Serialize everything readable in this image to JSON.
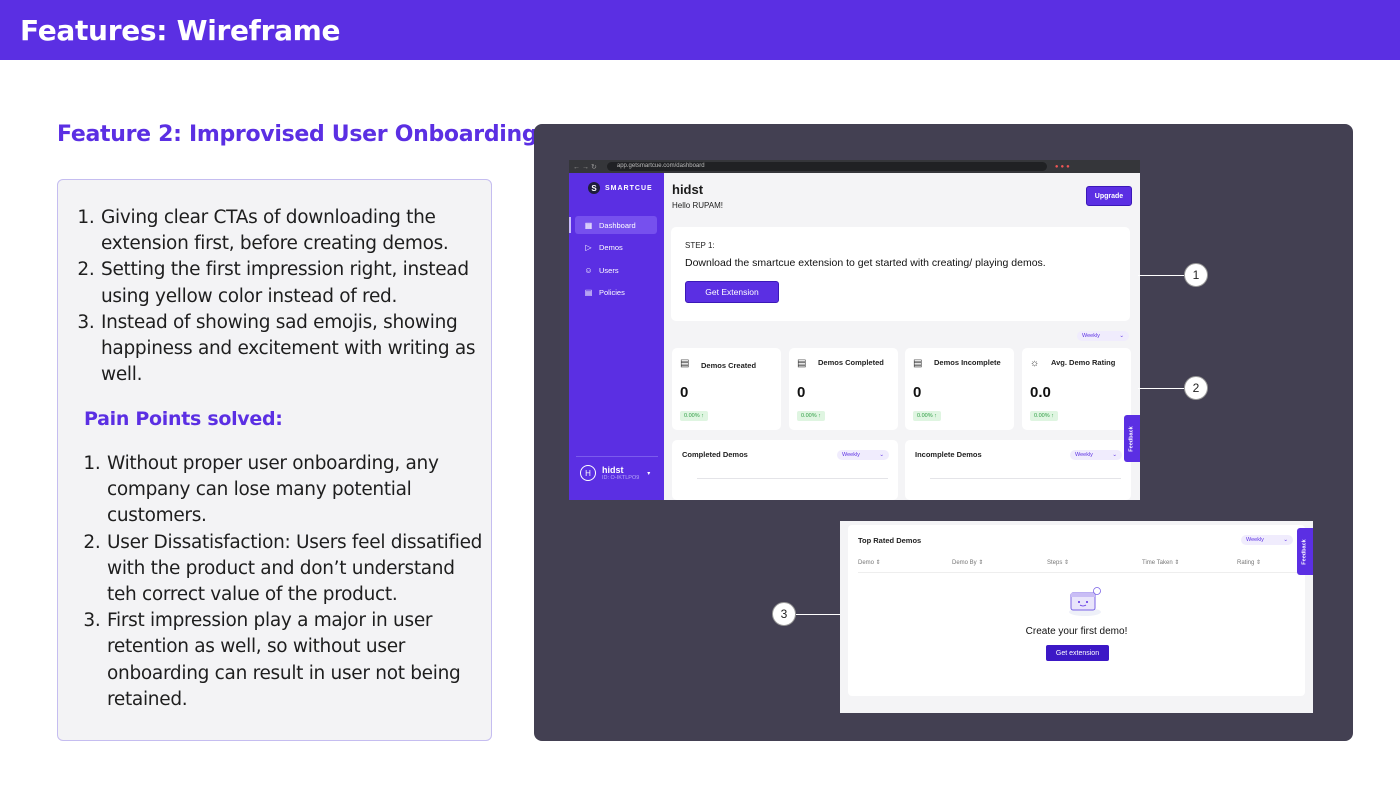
{
  "header": {
    "title": "Features: Wireframe"
  },
  "feature": {
    "title": "Feature 2: Improvised User Onboarding"
  },
  "points": [
    "Giving clear CTAs of downloading the extension first, before creating demos.",
    "Setting the first impression right, instead using yellow color instead of red.",
    "Instead of showing sad emojis, showing happiness and excitement with writing as well."
  ],
  "pain": {
    "title": "Pain Points solved:",
    "items": [
      "Without proper user onboarding, any company can lose many potential customers.",
      "User Dissatisfaction: Users feel dissatified with the product and don’t understand teh correct value of the product.",
      "First impression play a major in user retention as well, so without user onboarding can result in user not being retained."
    ]
  },
  "browser": {
    "url": "app.getsmartcue.com/dashboard",
    "logo_text": "SMARTCUE",
    "logo_mark": "S",
    "nav": [
      {
        "label": "Dashboard",
        "icon": "grid-icon"
      },
      {
        "label": "Demos",
        "icon": "play-icon"
      },
      {
        "label": "Users",
        "icon": "users-icon"
      },
      {
        "label": "Policies",
        "icon": "document-icon"
      }
    ],
    "user": {
      "name": "hidst",
      "initial": "H",
      "id": "ID: O-IKTLPO9"
    },
    "main_title": "hidst",
    "greeting": "Hello RUPAM!",
    "upgrade_label": "Upgrade",
    "step": {
      "label": "STEP 1:",
      "text": "Download the smartcue extension to get started with creating/ playing demos.",
      "button": "Get Extension"
    },
    "period": "Weekly",
    "stats": [
      {
        "label": "Demos Created",
        "value": "0",
        "change": "0.00% ↑"
      },
      {
        "label": "Demos Completed",
        "value": "0",
        "change": "0.00% ↑"
      },
      {
        "label": "Demos Incomplete",
        "value": "0",
        "change": "0.00% ↑"
      },
      {
        "label": "Avg. Demo Rating",
        "value": "0.0",
        "change": "0.00% ↑"
      }
    ],
    "charts": [
      {
        "title": "Completed Demos",
        "period": "Weekly"
      },
      {
        "title": "Incomplete Demos",
        "period": "Weekly"
      }
    ],
    "feedback": "Feedback"
  },
  "table": {
    "title": "Top Rated Demos",
    "period": "Weekly",
    "columns": [
      "Demo",
      "Demo By",
      "Steps",
      "Time Taken",
      "Rating"
    ],
    "empty_text": "Create your first demo!",
    "button": "Get extension",
    "feedback": "Feedback"
  },
  "callouts": [
    "1",
    "2",
    "3"
  ],
  "colors": {
    "brand": "#5b2fe3",
    "panel": "#434052",
    "success": "#2f9e44"
  }
}
